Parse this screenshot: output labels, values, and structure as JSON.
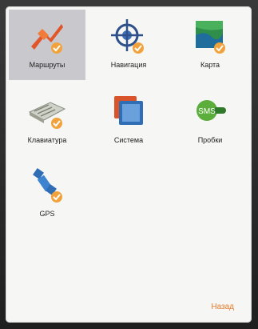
{
  "screen": {
    "tiles": [
      {
        "label": "Маршруты",
        "icon": "route-pin-icon",
        "selected": true
      },
      {
        "label": "Навигация",
        "icon": "crosshair-target-icon",
        "selected": false
      },
      {
        "label": "Карта",
        "icon": "map-icon",
        "selected": false
      },
      {
        "label": "Клавиатура",
        "icon": "keyboard-icon",
        "selected": false
      },
      {
        "label": "Система",
        "icon": "system-windows-icon",
        "selected": false
      },
      {
        "label": "Пробки",
        "icon": "traffic-sms-icon",
        "selected": false
      },
      {
        "label": "GPS",
        "icon": "gps-satellite-icon",
        "selected": false
      }
    ],
    "menu_label": "Назад"
  },
  "colors": {
    "selected_bg": "#c9c9cd",
    "accent": "#e87a2a"
  }
}
